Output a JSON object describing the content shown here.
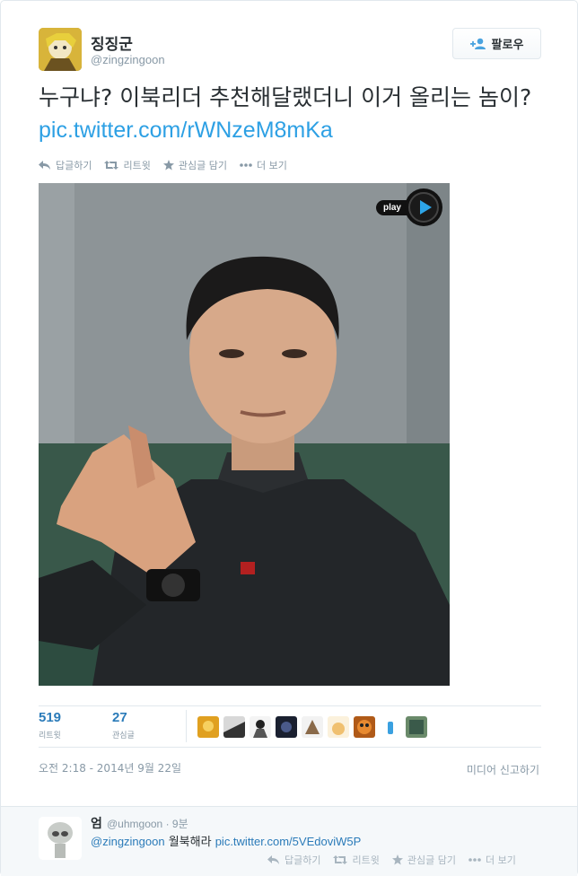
{
  "tweet": {
    "display_name": "징징군",
    "handle": "@zingzingoon",
    "follow_label": "팔로우",
    "text_main": "누구냐? 이북리더 추천해달랬더니 이거 올리는 놈이? ",
    "text_link": "pic.twitter.com/rWNzeM8mKa",
    "actions": {
      "reply": "답글하기",
      "retweet": "리트윗",
      "favorite": "관심글 담기",
      "more": "더 보기"
    },
    "media": {
      "play_label": "play"
    },
    "stats": {
      "retweets_count": "519",
      "retweets_label": "리트윗",
      "favorites_count": "27",
      "favorites_label": "관심글"
    },
    "timestamp": "오전 2:18 - 2014년 9월 22일",
    "report_label": "미디어 신고하기"
  },
  "reply": {
    "display_name": "엄",
    "handle": "@uhmgoon",
    "time": "· 9분",
    "mention": "@zingzingoon",
    "text": " 월북해라 ",
    "link": "pic.twitter.com/5VEdoviW5P",
    "actions": {
      "reply": "답글하기",
      "retweet": "리트윗",
      "favorite": "관심글 담기",
      "more": "더 보기"
    }
  },
  "colors": {
    "link": "#2b7bb9",
    "muted": "#8899a6",
    "text": "#292f33",
    "border": "#e1e8ed"
  }
}
